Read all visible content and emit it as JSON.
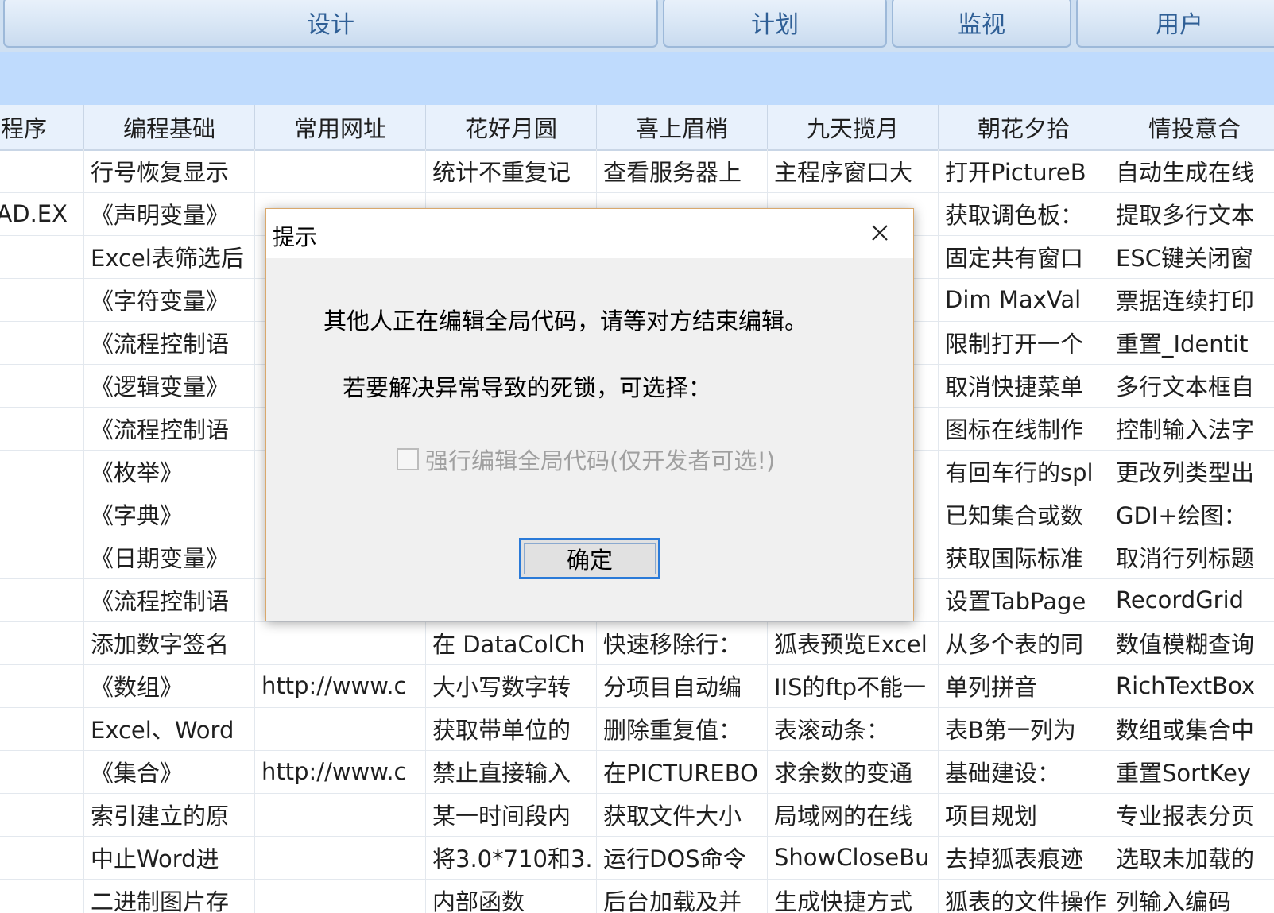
{
  "toolbar": {
    "buttons": [
      "设计",
      "计划",
      "监视",
      "用户"
    ]
  },
  "grid": {
    "columns": [
      "程序",
      "编程基础",
      "常用网址",
      "花好月圆",
      "喜上眉梢",
      "九天揽月",
      "朝花夕拾",
      "情投意合"
    ],
    "rows": [
      [
        "",
        "行号恢复显示",
        "",
        "统计不重复记",
        "查看服务器上",
        "主程序窗口大",
        "打开PictureB",
        "自动生成在线"
      ],
      [
        "AD.EX",
        "《声明变量》",
        "",
        "",
        "",
        "",
        "获取调色板：",
        "提取多行文本"
      ],
      [
        "",
        "Excel表筛选后",
        "",
        "",
        "",
        "",
        "固定共有窗口",
        "ESC键关闭窗"
      ],
      [
        "",
        "《字符变量》",
        "",
        "",
        "",
        "",
        "Dim MaxVal",
        "票据连续打印"
      ],
      [
        "",
        "《流程控制语",
        "",
        "",
        "",
        "",
        "限制打开一个",
        "重置_Identit"
      ],
      [
        "",
        "《逻辑变量》",
        "",
        "",
        "",
        "",
        "取消快捷菜单",
        "多行文本框自"
      ],
      [
        "",
        "《流程控制语",
        "",
        "",
        "",
        "",
        "图标在线制作",
        "控制输入法字"
      ],
      [
        "",
        "《枚举》",
        "",
        "",
        "",
        "",
        "有回车行的spl",
        "更改列类型出"
      ],
      [
        "",
        "《字典》",
        "",
        "",
        "",
        "",
        "已知集合或数",
        "GDI+绘图："
      ],
      [
        "",
        "《日期变量》",
        "",
        "",
        "",
        "",
        "获取国际标准",
        "取消行列标题"
      ],
      [
        "",
        "《流程控制语",
        "",
        "",
        "",
        "",
        "设置TabPage",
        "RecordGrid"
      ],
      [
        "",
        "添加数字签名",
        "",
        "在 DataColCh",
        "快速移除行：",
        "狐表预览Excel",
        "从多个表的同",
        "数值模糊查询"
      ],
      [
        "",
        "《数组》",
        "http://www.c",
        "大小写数字转",
        "分项目自动编",
        "IIS的ftp不能一",
        "单列拼音",
        "RichTextBox"
      ],
      [
        "",
        "Excel、Word",
        "",
        "获取带单位的",
        "删除重复值：",
        "表滚动条：",
        "表B第一列为",
        "数组或集合中"
      ],
      [
        "",
        "《集合》",
        "http://www.c",
        "禁止直接输入",
        "在PICTUREBO",
        "求余数的变通",
        "基础建设：",
        "重置SortKey"
      ],
      [
        "",
        "索引建立的原",
        "",
        "某一时间段内",
        "获取文件大小",
        "局域网的在线",
        "项目规划",
        "专业报表分页"
      ],
      [
        "",
        "中止Word进",
        "",
        "将3.0*710和3.",
        "运行DOS命令",
        "ShowCloseBu",
        "去掉狐表痕迹",
        "选取未加载的"
      ],
      [
        "",
        "二进制图片存",
        "",
        "内部函数",
        "后台加载及并",
        "生成快捷方式",
        "狐表的文件操作",
        "列输入编码"
      ]
    ]
  },
  "dialog": {
    "title": "提示",
    "close_icon": "close-icon",
    "message_line1": "其他人正在编辑全局代码，请等对方结束编辑。",
    "message_line2": "若要解决异常导致的死锁，可选择：",
    "checkbox_label": "强行编辑全局代码(仅开发者可选!)",
    "checkbox_checked": false,
    "checkbox_enabled": false,
    "ok_label": "确定"
  },
  "colors": {
    "toolbar_text": "#2f5f96",
    "strip_bg": "#bfdbfd",
    "header_bg": "#e8f1fc",
    "dialog_border": "#d9a86c",
    "ok_focus_border": "#2a7ad8"
  }
}
